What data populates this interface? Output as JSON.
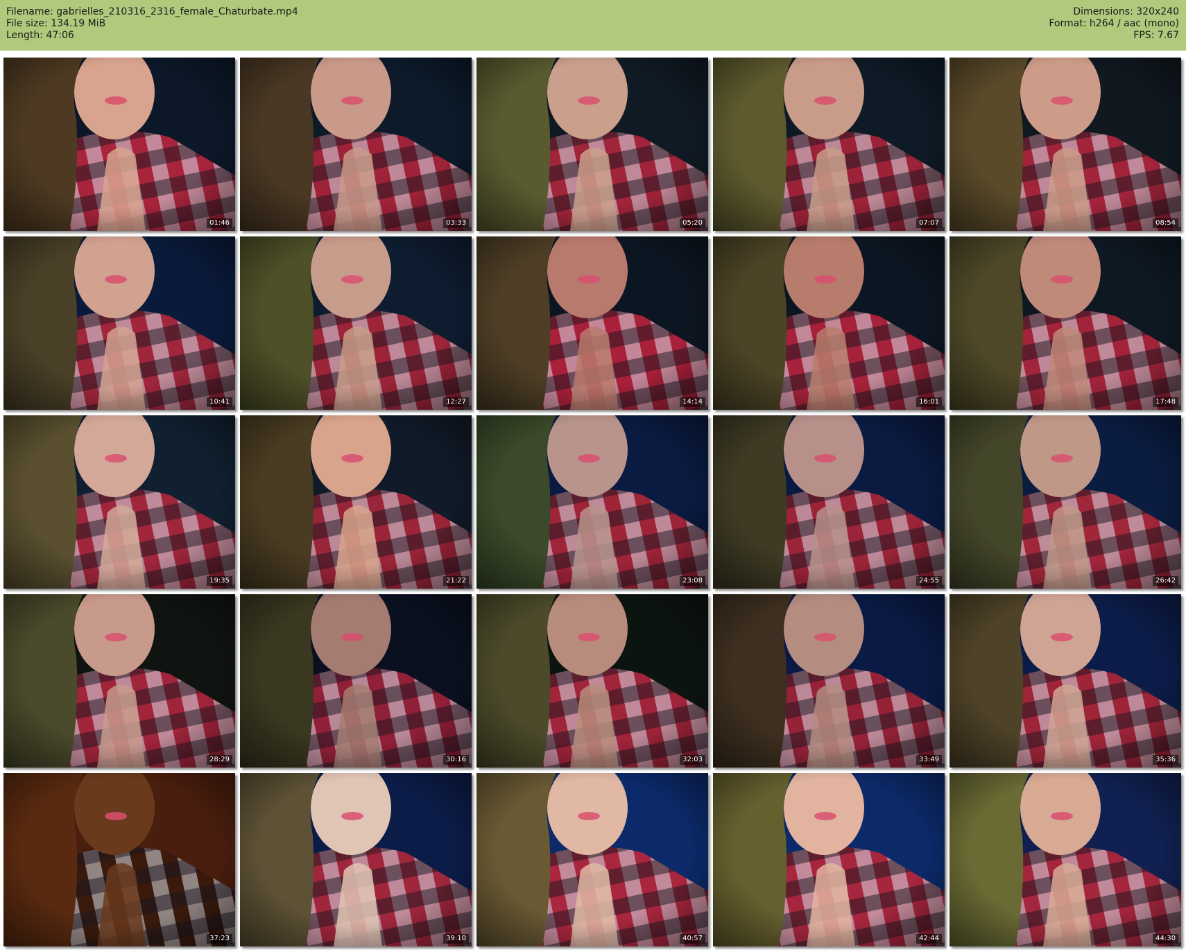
{
  "header": {
    "filename": "Filename: gabrielles_210316_2316_female_Chaturbate.mp4",
    "filesize": "File size: 134.19 MiB",
    "length": "Length: 47:06",
    "dimensions": "Dimensions: 320x240",
    "format": "Format: h264 / aac (mono)",
    "fps": "FPS: 7.67",
    "bg_color": "#afc97d"
  },
  "thumbnails": [
    {
      "time": "01:46",
      "bg": "#0c1828",
      "hair": "#4e3a22",
      "skin": "#d9a48f",
      "shirt": "#a8243c"
    },
    {
      "time": "03:33",
      "bg": "#0c1a2a",
      "hair": "#4a3824",
      "skin": "#c99a8a",
      "shirt": "#9e2238"
    },
    {
      "time": "05:20",
      "bg": "#101a24",
      "hair": "#5a5a30",
      "skin": "#caa08c",
      "shirt": "#a0243a"
    },
    {
      "time": "07:07",
      "bg": "#0e1a26",
      "hair": "#5e5a2e",
      "skin": "#c89c88",
      "shirt": "#9c2238"
    },
    {
      "time": "08:54",
      "bg": "#101820",
      "hair": "#5a4a2a",
      "skin": "#cc9c88",
      "shirt": "#a2243a"
    },
    {
      "time": "10:41",
      "bg": "#0a1a3a",
      "hair": "#4a4028",
      "skin": "#d2a290",
      "shirt": "#a0263c"
    },
    {
      "time": "12:27",
      "bg": "#0e1c30",
      "hair": "#4e5028",
      "skin": "#c89c8a",
      "shirt": "#9c2438"
    },
    {
      "time": "14:14",
      "bg": "#0c1622",
      "hair": "#4e3e26",
      "skin": "#b87a6c",
      "shirt": "#a8203a"
    },
    {
      "time": "16:01",
      "bg": "#0c1622",
      "hair": "#4c4426",
      "skin": "#b87c6c",
      "shirt": "#a6223a"
    },
    {
      "time": "17:48",
      "bg": "#0e1822",
      "hair": "#4e4828",
      "skin": "#c08a7a",
      "shirt": "#a2243a"
    },
    {
      "time": "19:35",
      "bg": "#102030",
      "hair": "#5a5030",
      "skin": "#d4a898",
      "shirt": "#a0263c"
    },
    {
      "time": "21:22",
      "bg": "#101a28",
      "hair": "#4a3c22",
      "skin": "#d8a48c",
      "shirt": "#9a2438"
    },
    {
      "time": "23:08",
      "bg": "#0a1a40",
      "hair": "#3a4a2a",
      "skin": "#b8948c",
      "shirt": "#9e2438"
    },
    {
      "time": "24:55",
      "bg": "#0a1a40",
      "hair": "#3e3a24",
      "skin": "#b8908a",
      "shirt": "#9c2438"
    },
    {
      "time": "26:42",
      "bg": "#0a1c40",
      "hair": "#44462a",
      "skin": "#c09888",
      "shirt": "#a0263a"
    },
    {
      "time": "28:29",
      "bg": "#101410",
      "hair": "#4a4a2c",
      "skin": "#c89a8c",
      "shirt": "#a0243a"
    },
    {
      "time": "30:16",
      "bg": "#0a1020",
      "hair": "#3a3820",
      "skin": "#a47c72",
      "shirt": "#902038"
    },
    {
      "time": "32:03",
      "bg": "#0c1410",
      "hair": "#4c4a2a",
      "skin": "#b88c7c",
      "shirt": "#a0243a"
    },
    {
      "time": "33:49",
      "bg": "#0a1a44",
      "hair": "#3e3020",
      "skin": "#b48c80",
      "shirt": "#962238"
    },
    {
      "time": "35:36",
      "bg": "#0c1c48",
      "hair": "#4e4228",
      "skin": "#d0a494",
      "shirt": "#9e2438"
    },
    {
      "time": "37:23",
      "bg": "#4a1e0e",
      "hair": "#5a2a10",
      "skin": "#6a3a1c",
      "shirt": "#3a1a0c"
    },
    {
      "time": "39:10",
      "bg": "#0c1c48",
      "hair": "#5e5236",
      "skin": "#e0c4b4",
      "shirt": "#a0263c"
    },
    {
      "time": "40:57",
      "bg": "#0c2a6a",
      "hair": "#6a5a34",
      "skin": "#e0b8a4",
      "shirt": "#a8263e"
    },
    {
      "time": "42:44",
      "bg": "#0c2a6a",
      "hair": "#66602e",
      "skin": "#e2b4a0",
      "shirt": "#a6263e"
    },
    {
      "time": "44:30",
      "bg": "#102050",
      "hair": "#6a6a34",
      "skin": "#d8aa94",
      "shirt": "#a4263c"
    }
  ]
}
